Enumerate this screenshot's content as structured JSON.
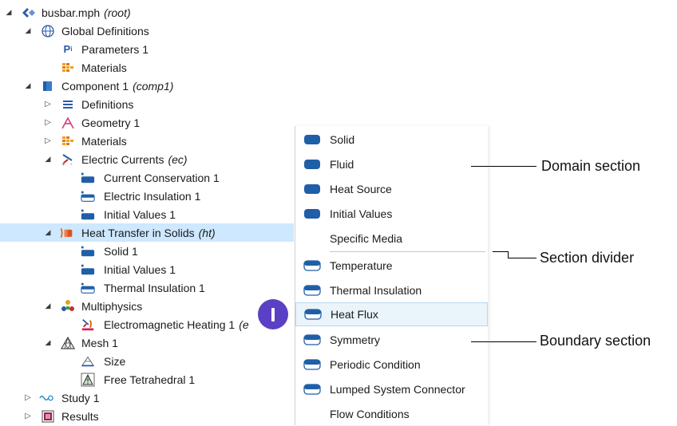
{
  "tree": {
    "root": {
      "label": "busbar.mph",
      "tag": "(root)"
    },
    "global_definitions": {
      "label": "Global Definitions"
    },
    "parameters": {
      "label": "Parameters 1"
    },
    "materials_global": {
      "label": "Materials"
    },
    "component": {
      "label": "Component 1",
      "tag": "(comp1)"
    },
    "definitions": {
      "label": "Definitions"
    },
    "geometry": {
      "label": "Geometry 1"
    },
    "materials_comp": {
      "label": "Materials"
    },
    "electric_currents": {
      "label": "Electric Currents",
      "tag": "(ec)"
    },
    "current_conservation": {
      "label": "Current Conservation 1"
    },
    "electric_insulation": {
      "label": "Electric Insulation 1"
    },
    "initial_values_ec": {
      "label": "Initial Values 1"
    },
    "heat_transfer": {
      "label": "Heat Transfer in Solids",
      "tag": "(ht)"
    },
    "solid": {
      "label": "Solid 1"
    },
    "initial_values_ht": {
      "label": "Initial Values 1"
    },
    "thermal_insulation": {
      "label": "Thermal Insulation 1"
    },
    "multiphysics": {
      "label": "Multiphysics"
    },
    "em_heating": {
      "label": "Electromagnetic Heating 1",
      "tag": "(e"
    },
    "mesh": {
      "label": "Mesh 1"
    },
    "size": {
      "label": "Size"
    },
    "free_tet": {
      "label": "Free Tetrahedral 1"
    },
    "study": {
      "label": "Study 1"
    },
    "results": {
      "label": "Results"
    }
  },
  "menu": {
    "domain": [
      {
        "label": "Solid"
      },
      {
        "label": "Fluid"
      },
      {
        "label": "Heat Source"
      },
      {
        "label": "Initial Values"
      },
      {
        "label": "Specific Media"
      }
    ],
    "boundary": [
      {
        "label": "Temperature"
      },
      {
        "label": "Thermal Insulation"
      },
      {
        "label": "Heat Flux"
      },
      {
        "label": "Symmetry"
      },
      {
        "label": "Periodic Condition"
      },
      {
        "label": "Lumped System Connector"
      },
      {
        "label": "Flow Conditions"
      }
    ]
  },
  "callouts": {
    "domain": "Domain section",
    "divider": "Section divider",
    "boundary": "Boundary section"
  },
  "colors": {
    "selection": "#cde8ff",
    "menu_icon_blue": "#1f5fa8",
    "cursor": "#5b3fc4"
  }
}
